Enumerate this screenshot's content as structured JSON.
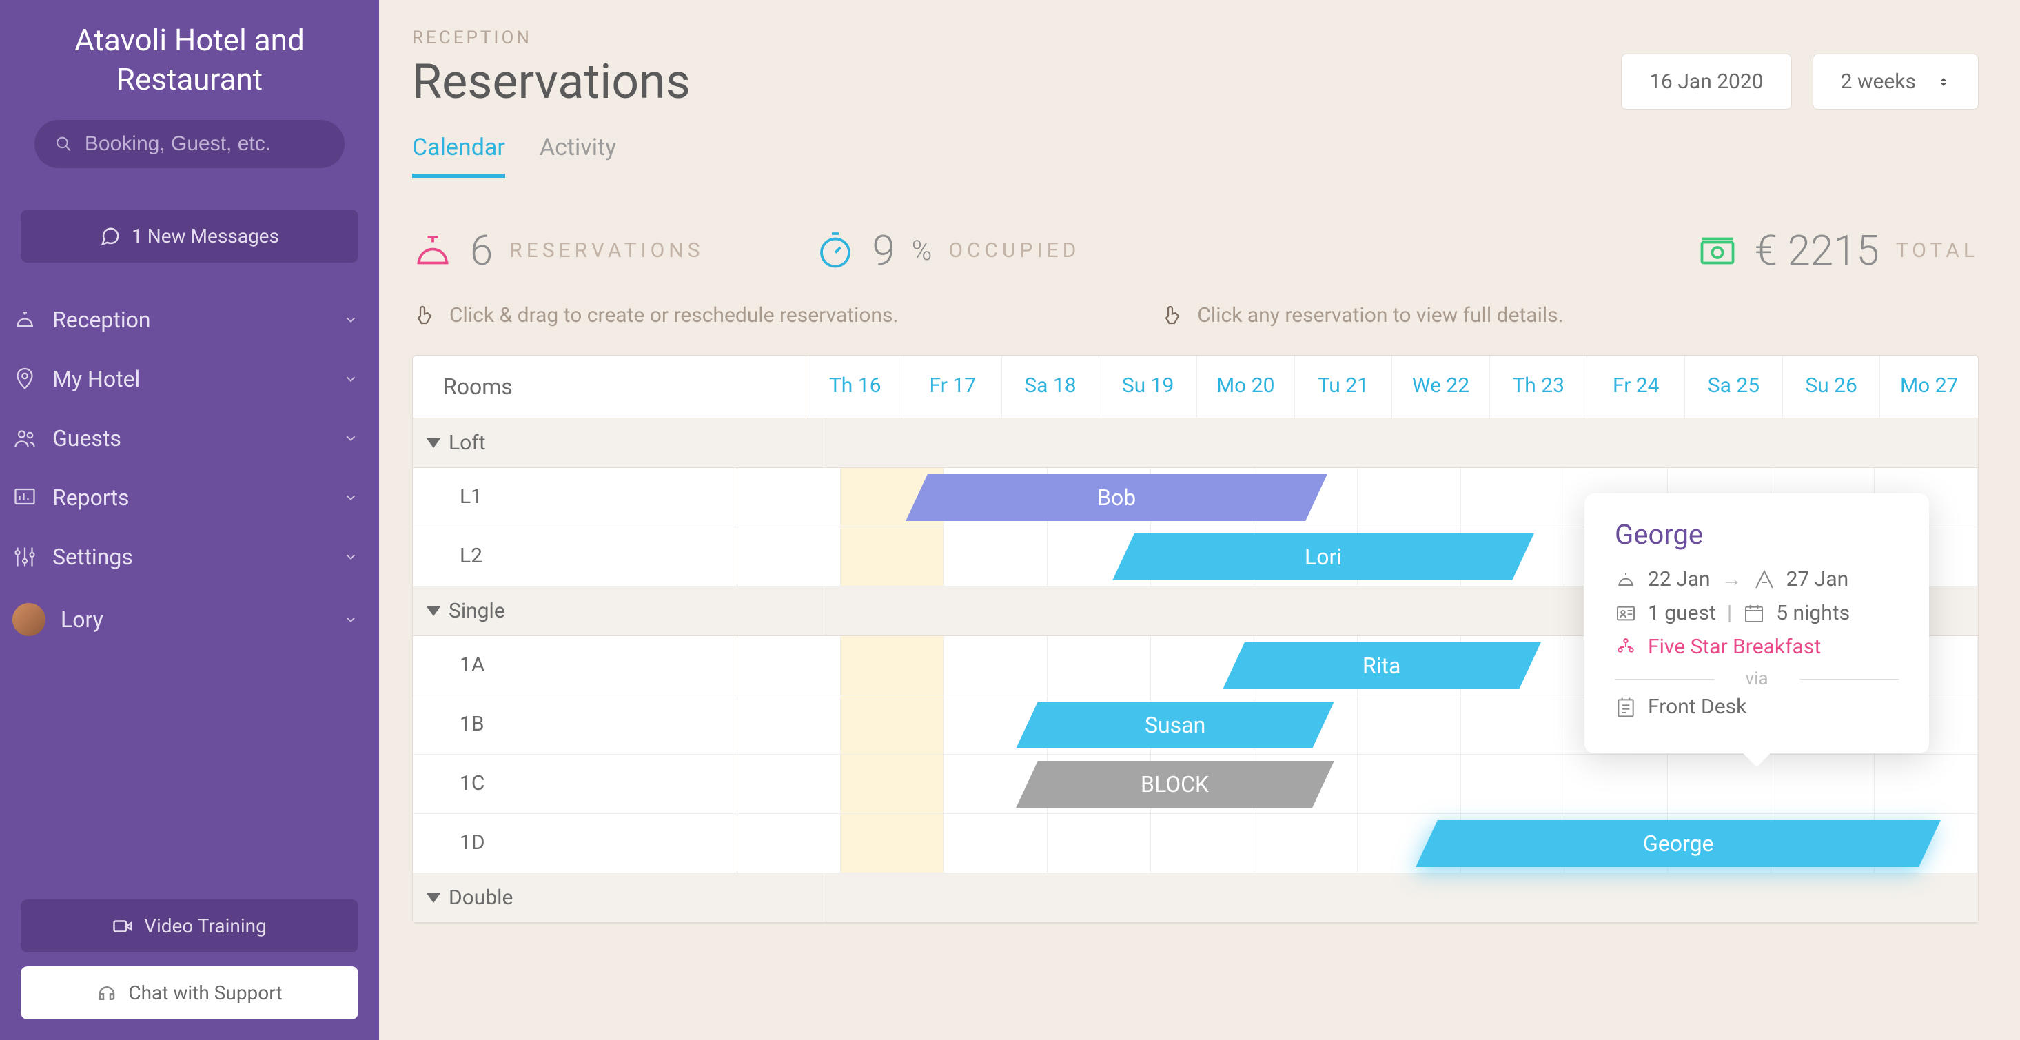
{
  "sidebar": {
    "brand": "Atavoli Hotel and Restaurant",
    "search_placeholder": "Booking, Guest, etc.",
    "messages_label": "1 New Messages",
    "nav": [
      {
        "label": "Reception",
        "icon": "bell"
      },
      {
        "label": "My Hotel",
        "icon": "pin"
      },
      {
        "label": "Guests",
        "icon": "people"
      },
      {
        "label": "Reports",
        "icon": "report"
      },
      {
        "label": "Settings",
        "icon": "sliders"
      }
    ],
    "user": "Lory",
    "video_label": "Video Training",
    "chat_label": "Chat with Support"
  },
  "header": {
    "breadcrumb": "RECEPTION",
    "title": "Reservations",
    "date": "16 Jan 2020",
    "range": "2 weeks"
  },
  "tabs": {
    "calendar": "Calendar",
    "activity": "Activity"
  },
  "stats": {
    "reservations_count": "6",
    "reservations_label": "RESERVATIONS",
    "occupied_count": "9",
    "occupied_pct": "%",
    "occupied_label": "OCCUPIED",
    "total_amount": "€ 2215",
    "total_label": "TOTAL"
  },
  "hints": {
    "drag": "Click & drag to create or reschedule reservations.",
    "click": "Click any reservation to view full details."
  },
  "calendar": {
    "rooms_header": "Rooms",
    "days": [
      "Th 16",
      "Fr 17",
      "Sa 18",
      "Su 19",
      "Mo 20",
      "Tu 21",
      "We 22",
      "Th 23",
      "Fr 24",
      "Sa 25",
      "Su 26",
      "Mo 27"
    ],
    "groups": [
      {
        "name": "Loft",
        "rooms": [
          "L1",
          "L2"
        ]
      },
      {
        "name": "Single",
        "rooms": [
          "1A",
          "1B",
          "1C",
          "1D"
        ]
      },
      {
        "name": "Double",
        "rooms": []
      }
    ],
    "reservations": {
      "bob": "Bob",
      "lori": "Lori",
      "rita": "Rita",
      "susan": "Susan",
      "block": "BLOCK",
      "george": "George"
    }
  },
  "tooltip": {
    "name": "George",
    "checkin": "22 Jan",
    "checkout": "27 Jan",
    "guests": "1 guest",
    "separator": "|",
    "nights": "5 nights",
    "plan": "Five Star Breakfast",
    "via_label": "via",
    "source": "Front Desk"
  },
  "colors": {
    "sidebar": "#6c4f9c",
    "accent": "#2eb3df",
    "pink": "#e94b8a",
    "green": "#3cc97a"
  }
}
